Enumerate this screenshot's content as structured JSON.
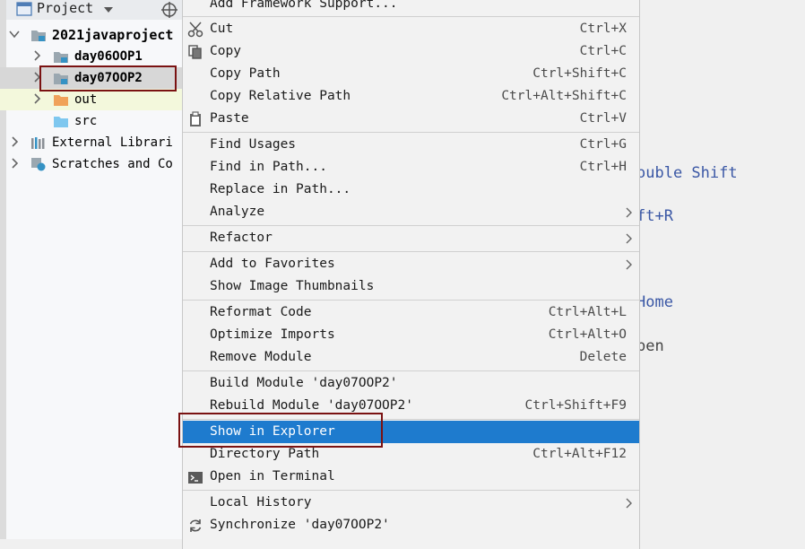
{
  "project_panel": {
    "header_title": "Project",
    "tree": [
      {
        "label": "2021javaproject",
        "bold": true
      },
      {
        "label": "day06OOP1",
        "bold": true
      },
      {
        "label": "day07OOP2",
        "bold": true
      },
      {
        "label": "out",
        "bold": false
      },
      {
        "label": "src",
        "bold": false
      },
      {
        "label": "External Librari",
        "bold": false
      },
      {
        "label": "Scratches and Co",
        "bold": false
      }
    ]
  },
  "editor_hints": {
    "search": "ouble Shift",
    "recent": "ft+R",
    "nav": "Home",
    "open": "pen"
  },
  "context_menu": {
    "items": [
      {
        "label": "Add Framework Support...",
        "shortcut": ""
      },
      {
        "label": "Cut",
        "shortcut": "Ctrl+X",
        "icon": "scissors-icon"
      },
      {
        "label": "Copy",
        "shortcut": "Ctrl+C",
        "icon": "copy-icon"
      },
      {
        "label": "Copy Path",
        "shortcut": "Ctrl+Shift+C"
      },
      {
        "label": "Copy Relative Path",
        "shortcut": "Ctrl+Alt+Shift+C"
      },
      {
        "label": "Paste",
        "shortcut": "Ctrl+V",
        "icon": "clipboard-icon"
      },
      {
        "label": "Find Usages",
        "shortcut": "Ctrl+G"
      },
      {
        "label": "Find in Path...",
        "shortcut": "Ctrl+H"
      },
      {
        "label": "Replace in Path...",
        "shortcut": ""
      },
      {
        "label": "Analyze",
        "shortcut": "",
        "submenu": true
      },
      {
        "label": "Refactor",
        "shortcut": "",
        "submenu": true
      },
      {
        "label": "Add to Favorites",
        "shortcut": "",
        "submenu": true
      },
      {
        "label": "Show Image Thumbnails",
        "shortcut": ""
      },
      {
        "label": "Reformat Code",
        "shortcut": "Ctrl+Alt+L"
      },
      {
        "label": "Optimize Imports",
        "shortcut": "Ctrl+Alt+O"
      },
      {
        "label": "Remove Module",
        "shortcut": "Delete"
      },
      {
        "label": "Build Module 'day07OOP2'",
        "shortcut": ""
      },
      {
        "label": "Rebuild Module 'day07OOP2'",
        "shortcut": "Ctrl+Shift+F9"
      },
      {
        "label": "Show in Explorer",
        "shortcut": "",
        "active": true
      },
      {
        "label": "Directory Path",
        "shortcut": "Ctrl+Alt+F12"
      },
      {
        "label": "Open in Terminal",
        "shortcut": "",
        "icon": "terminal-icon"
      },
      {
        "label": "Local History",
        "shortcut": "",
        "submenu": true
      },
      {
        "label": "Synchronize 'day07OOP2'",
        "shortcut": "",
        "icon": "sync-icon"
      }
    ]
  },
  "colors": {
    "selection": "#1e7bce",
    "annotation": "#7a1212",
    "folder": "#9aa7b0",
    "module_badge": "#3592c4",
    "out_folder": "#f0a25a",
    "src_folder": "#7ec7ef"
  }
}
